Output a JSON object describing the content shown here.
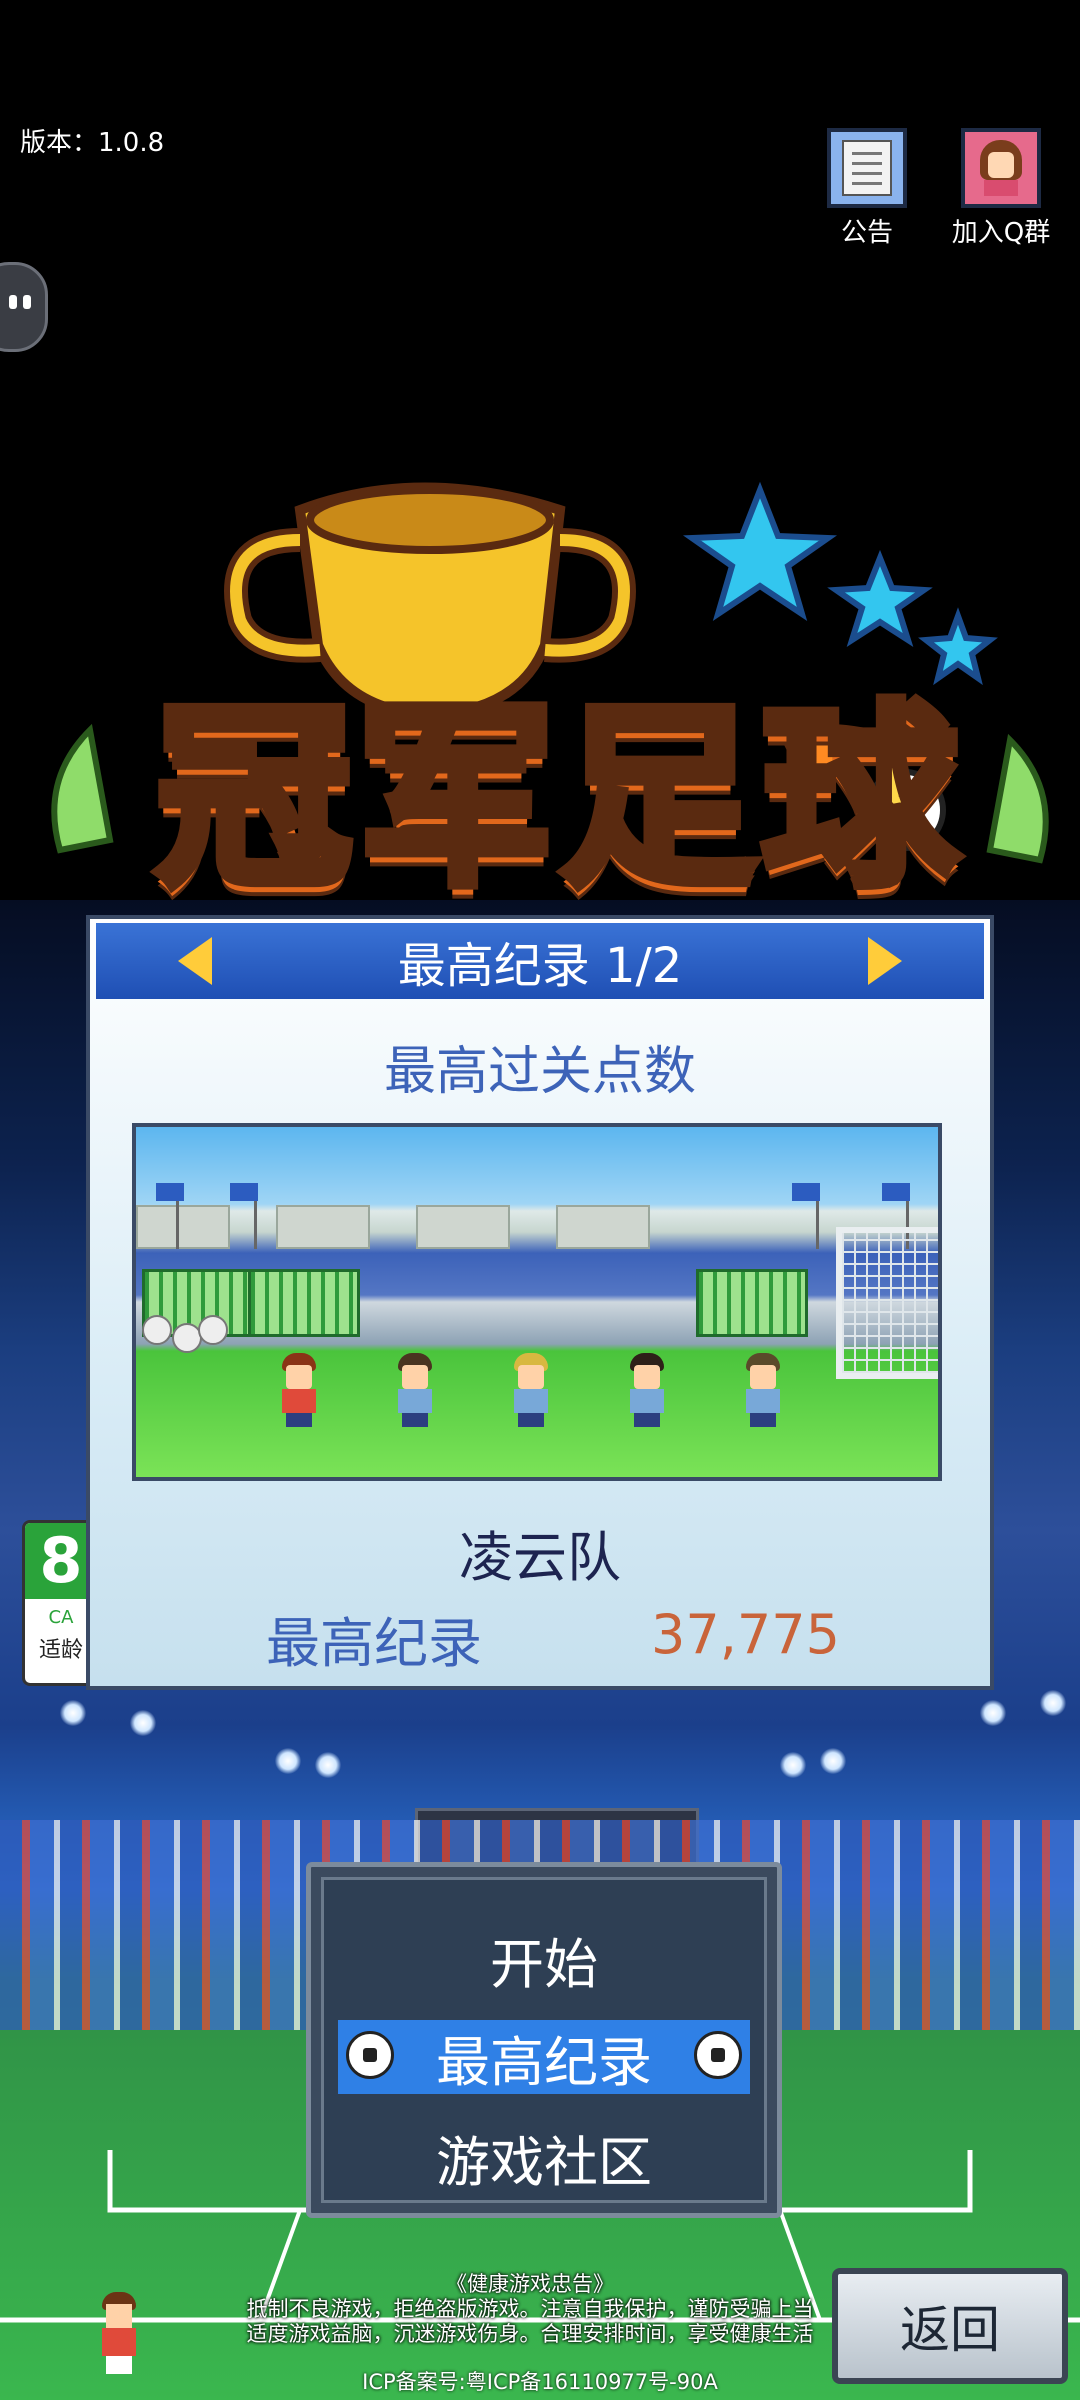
{
  "header": {
    "version": "版本：1.0.8",
    "notice_label": "公告",
    "qq_group_label": "加入Q群"
  },
  "logo": {
    "text": "冠军足球"
  },
  "age_rating": {
    "number": "8",
    "code": "CA",
    "label": "适龄"
  },
  "record_dialog": {
    "title": "最高纪录 1/2",
    "subtitle": "最高过关点数",
    "team_name": "凌云队",
    "record_label": "最高纪录",
    "record_value": "37,775"
  },
  "menu": {
    "items": [
      {
        "label": "开始"
      },
      {
        "label": "最高纪录",
        "selected": true
      },
      {
        "label": "游戏社区"
      }
    ]
  },
  "footer": {
    "notice_title": "《健康游戏忠告》",
    "notice_line1": "抵制不良游戏，拒绝盗版游戏。注意自我保护，谨防受骗上当",
    "notice_line2": "适度游戏益脑，沉迷游戏伤身。合理安排时间，享受健康生活",
    "icp": "ICP备案号:粤ICP备16110977号-90A",
    "back_label": "返回"
  },
  "colors": {
    "dialog_header": "#2457c0",
    "menu_selected": "#2f80e6",
    "record_value": "#c9643a",
    "subtitle": "#3d63b8"
  },
  "icons": [
    "notice-doc-icon",
    "qq-girl-icon",
    "float-assistant-icon",
    "prev-arrow-icon",
    "next-arrow-icon",
    "soccer-ball-icon"
  ]
}
